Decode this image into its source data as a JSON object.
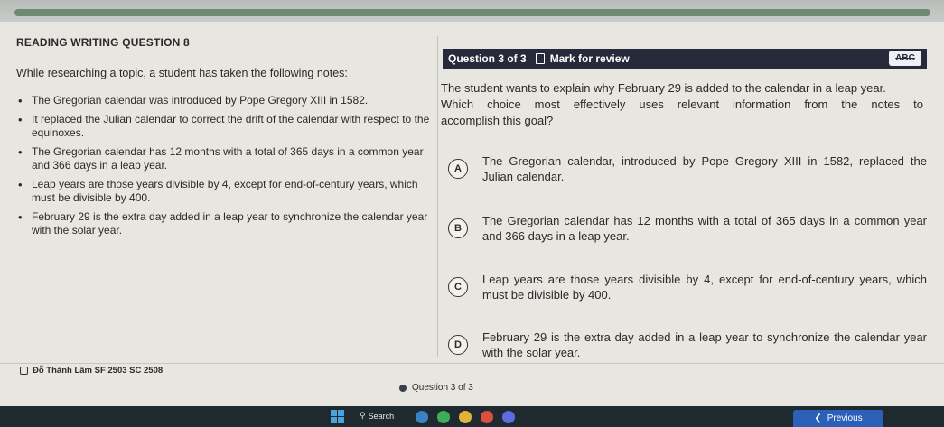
{
  "header": {
    "section_title": "READING WRITING QUESTION 8"
  },
  "passage": {
    "intro": "While researching a topic, a student has taken the following notes:",
    "notes": [
      "The Gregorian calendar was introduced by Pope Gregory XIII in 1582.",
      "It replaced the Julian calendar to correct the drift of the calendar with respect to the equinoxes.",
      "The Gregorian calendar has 12 months with a total of 365 days in a common year and 366 days in a leap year.",
      "Leap years are those years divisible by 4, except for end-of-century years, which must be divisible by 400.",
      "February 29 is the extra day added in a leap year to synchronize the calendar year with the solar year."
    ]
  },
  "question": {
    "counter": "Question 3 of 3",
    "mark_label": "Mark for review",
    "abc_label": "ABC",
    "stem_line1": "The student wants to explain why February 29 is added to the calendar in a leap year.",
    "stem_line2": "Which choice most effectively uses relevant information from the notes to",
    "stem_line3": "accomplish this goal?",
    "choices": [
      {
        "letter": "A",
        "text": "The Gregorian calendar, introduced by Pope Gregory XIII in 1582, replaced the Julian calendar."
      },
      {
        "letter": "B",
        "text": "The Gregorian calendar has 12 months with a total of 365 days in a common year and 366 days in a leap year."
      },
      {
        "letter": "C",
        "text": "Leap years are those years divisible by 4, except for end-of-century years, which must be divisible by 400."
      },
      {
        "letter": "D",
        "text": "February 29 is the extra day added in a leap year to synchronize the calendar year with the solar year."
      }
    ]
  },
  "footer": {
    "student_name": "Đỗ Thành Lâm SF 2503 SC 2508",
    "question_nav": "Question 3 of 3",
    "previous_label": "Previous"
  },
  "taskbar": {
    "search_label": "Search"
  },
  "colors": {
    "accent": "#262a3a",
    "progress": "#6e8a72",
    "previous_button": "#2c5fb8"
  }
}
